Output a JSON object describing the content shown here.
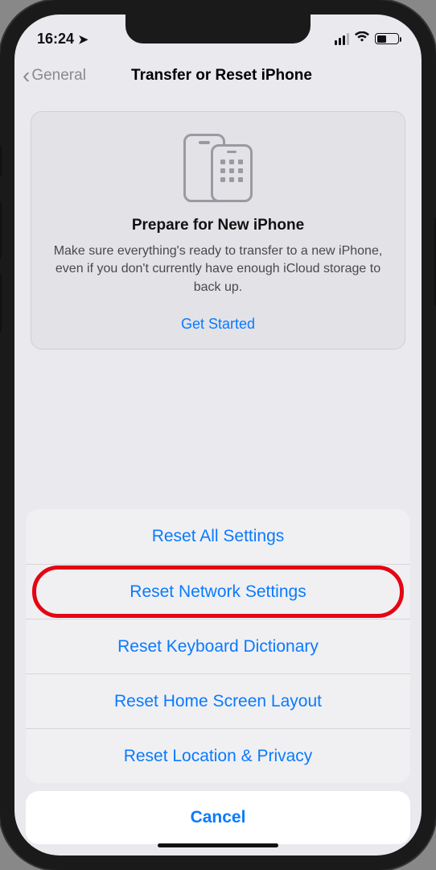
{
  "status_bar": {
    "time": "16:24"
  },
  "nav": {
    "back_label": "General",
    "title": "Transfer or Reset iPhone"
  },
  "prepare_card": {
    "title": "Prepare for New iPhone",
    "description": "Make sure everything's ready to transfer to a new iPhone, even if you don't currently have enough iCloud storage to back up.",
    "cta": "Get Started"
  },
  "action_sheet": {
    "items": [
      "Reset All Settings",
      "Reset Network Settings",
      "Reset Keyboard Dictionary",
      "Reset Home Screen Layout",
      "Reset Location & Privacy"
    ],
    "cancel": "Cancel",
    "highlight_index": 1
  }
}
